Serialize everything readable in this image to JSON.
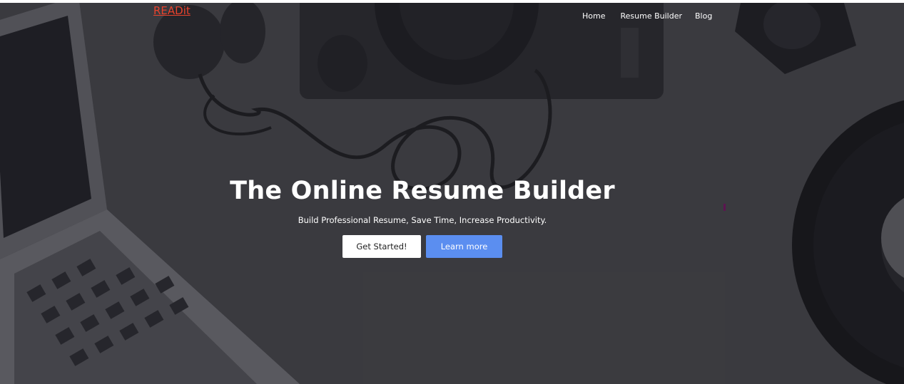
{
  "brand": {
    "name": "READit"
  },
  "nav": {
    "items": [
      {
        "label": "Home"
      },
      {
        "label": "Resume Builder"
      },
      {
        "label": "Blog"
      }
    ]
  },
  "hero": {
    "title": "The Online Resume Builder",
    "subtitle": "Build Professional Resume, Save Time, Increase Productivity.",
    "primary_button": "Get Started!",
    "secondary_button": "Learn more"
  },
  "colors": {
    "brand": "#e8432d",
    "accent_button": "#5b8ef0",
    "hero_background": "#3a3a3d"
  }
}
